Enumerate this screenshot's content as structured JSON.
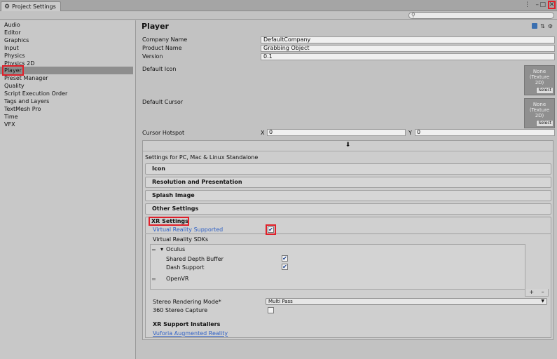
{
  "window": {
    "tab_title": "Project Settings",
    "controls": {
      "menu": "⋮",
      "minimize": "–",
      "maximize": "□",
      "close": "✕"
    }
  },
  "search": {
    "placeholder": "",
    "icon": "search-icon"
  },
  "sidebar": {
    "items": [
      {
        "label": "Audio"
      },
      {
        "label": "Editor"
      },
      {
        "label": "Graphics"
      },
      {
        "label": "Input"
      },
      {
        "label": "Physics"
      },
      {
        "label": "Physics 2D"
      },
      {
        "label": "Player",
        "selected": true
      },
      {
        "label": "Preset Manager"
      },
      {
        "label": "Quality"
      },
      {
        "label": "Script Execution Order"
      },
      {
        "label": "Tags and Layers"
      },
      {
        "label": "TextMesh Pro"
      },
      {
        "label": "Time"
      },
      {
        "label": "VFX"
      }
    ]
  },
  "player": {
    "title": "Player",
    "company_label": "Company Name",
    "company_value": "DefaultCompany",
    "product_label": "Product Name",
    "product_value": "Grabbing Object",
    "version_label": "Version",
    "version_value": "0.1",
    "default_icon_label": "Default Icon",
    "default_cursor_label": "Default Cursor",
    "tex_none": "None",
    "tex_type": "(Texture 2D)",
    "tex_select": "Select",
    "hotspot_label": "Cursor Hotspot",
    "hotspot_x_label": "X",
    "hotspot_x": "0",
    "hotspot_y_label": "Y",
    "hotspot_y": "0"
  },
  "platform": {
    "tab_icon": "⬇",
    "settings_for": "Settings for PC, Mac & Linux Standalone",
    "sections": {
      "icon": "Icon",
      "resolution": "Resolution and Presentation",
      "splash": "Splash Image",
      "other": "Other Settings"
    }
  },
  "xr": {
    "title": "XR Settings",
    "vr_supported_label": "Virtual Reality Supported",
    "vr_supported": true,
    "sdks_label": "Virtual Reality SDKs",
    "oculus_label": "Oculus",
    "shared_depth_label": "Shared Depth Buffer",
    "shared_depth": true,
    "dash_support_label": "Dash Support",
    "dash_support": true,
    "openvr_label": "OpenVR",
    "add": "+",
    "remove": "–",
    "stereo_mode_label": "Stereo Rendering Mode*",
    "stereo_mode_value": "Multi Pass",
    "stereo_capture_label": "360 Stereo Capture",
    "stereo_capture": false,
    "installers_title": "XR Support Installers",
    "vuforia_link": "Vuforia Augmented Reality"
  },
  "colors": {
    "highlight": "#e0202a",
    "link": "#2d5fc4",
    "selected": "#8e8e8e"
  }
}
